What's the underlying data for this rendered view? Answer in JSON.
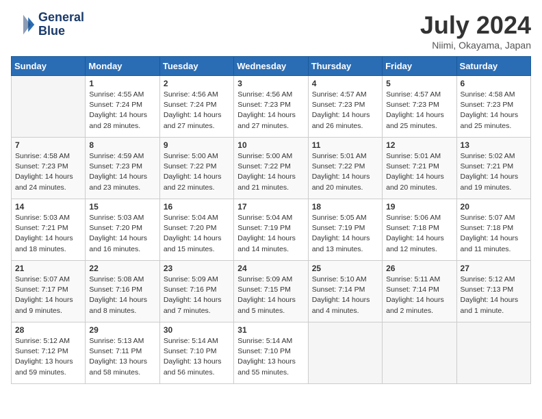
{
  "header": {
    "logo_line1": "General",
    "logo_line2": "Blue",
    "month_title": "July 2024",
    "location": "Niimi, Okayama, Japan"
  },
  "weekdays": [
    "Sunday",
    "Monday",
    "Tuesday",
    "Wednesday",
    "Thursday",
    "Friday",
    "Saturday"
  ],
  "weeks": [
    [
      {
        "day": "",
        "content": ""
      },
      {
        "day": "1",
        "content": "Sunrise: 4:55 AM\nSunset: 7:24 PM\nDaylight: 14 hours\nand 28 minutes."
      },
      {
        "day": "2",
        "content": "Sunrise: 4:56 AM\nSunset: 7:24 PM\nDaylight: 14 hours\nand 27 minutes."
      },
      {
        "day": "3",
        "content": "Sunrise: 4:56 AM\nSunset: 7:23 PM\nDaylight: 14 hours\nand 27 minutes."
      },
      {
        "day": "4",
        "content": "Sunrise: 4:57 AM\nSunset: 7:23 PM\nDaylight: 14 hours\nand 26 minutes."
      },
      {
        "day": "5",
        "content": "Sunrise: 4:57 AM\nSunset: 7:23 PM\nDaylight: 14 hours\nand 25 minutes."
      },
      {
        "day": "6",
        "content": "Sunrise: 4:58 AM\nSunset: 7:23 PM\nDaylight: 14 hours\nand 25 minutes."
      }
    ],
    [
      {
        "day": "7",
        "content": "Sunrise: 4:58 AM\nSunset: 7:23 PM\nDaylight: 14 hours\nand 24 minutes."
      },
      {
        "day": "8",
        "content": "Sunrise: 4:59 AM\nSunset: 7:23 PM\nDaylight: 14 hours\nand 23 minutes."
      },
      {
        "day": "9",
        "content": "Sunrise: 5:00 AM\nSunset: 7:22 PM\nDaylight: 14 hours\nand 22 minutes."
      },
      {
        "day": "10",
        "content": "Sunrise: 5:00 AM\nSunset: 7:22 PM\nDaylight: 14 hours\nand 21 minutes."
      },
      {
        "day": "11",
        "content": "Sunrise: 5:01 AM\nSunset: 7:22 PM\nDaylight: 14 hours\nand 20 minutes."
      },
      {
        "day": "12",
        "content": "Sunrise: 5:01 AM\nSunset: 7:21 PM\nDaylight: 14 hours\nand 20 minutes."
      },
      {
        "day": "13",
        "content": "Sunrise: 5:02 AM\nSunset: 7:21 PM\nDaylight: 14 hours\nand 19 minutes."
      }
    ],
    [
      {
        "day": "14",
        "content": "Sunrise: 5:03 AM\nSunset: 7:21 PM\nDaylight: 14 hours\nand 18 minutes."
      },
      {
        "day": "15",
        "content": "Sunrise: 5:03 AM\nSunset: 7:20 PM\nDaylight: 14 hours\nand 16 minutes."
      },
      {
        "day": "16",
        "content": "Sunrise: 5:04 AM\nSunset: 7:20 PM\nDaylight: 14 hours\nand 15 minutes."
      },
      {
        "day": "17",
        "content": "Sunrise: 5:04 AM\nSunset: 7:19 PM\nDaylight: 14 hours\nand 14 minutes."
      },
      {
        "day": "18",
        "content": "Sunrise: 5:05 AM\nSunset: 7:19 PM\nDaylight: 14 hours\nand 13 minutes."
      },
      {
        "day": "19",
        "content": "Sunrise: 5:06 AM\nSunset: 7:18 PM\nDaylight: 14 hours\nand 12 minutes."
      },
      {
        "day": "20",
        "content": "Sunrise: 5:07 AM\nSunset: 7:18 PM\nDaylight: 14 hours\nand 11 minutes."
      }
    ],
    [
      {
        "day": "21",
        "content": "Sunrise: 5:07 AM\nSunset: 7:17 PM\nDaylight: 14 hours\nand 9 minutes."
      },
      {
        "day": "22",
        "content": "Sunrise: 5:08 AM\nSunset: 7:16 PM\nDaylight: 14 hours\nand 8 minutes."
      },
      {
        "day": "23",
        "content": "Sunrise: 5:09 AM\nSunset: 7:16 PM\nDaylight: 14 hours\nand 7 minutes."
      },
      {
        "day": "24",
        "content": "Sunrise: 5:09 AM\nSunset: 7:15 PM\nDaylight: 14 hours\nand 5 minutes."
      },
      {
        "day": "25",
        "content": "Sunrise: 5:10 AM\nSunset: 7:14 PM\nDaylight: 14 hours\nand 4 minutes."
      },
      {
        "day": "26",
        "content": "Sunrise: 5:11 AM\nSunset: 7:14 PM\nDaylight: 14 hours\nand 2 minutes."
      },
      {
        "day": "27",
        "content": "Sunrise: 5:12 AM\nSunset: 7:13 PM\nDaylight: 14 hours\nand 1 minute."
      }
    ],
    [
      {
        "day": "28",
        "content": "Sunrise: 5:12 AM\nSunset: 7:12 PM\nDaylight: 13 hours\nand 59 minutes."
      },
      {
        "day": "29",
        "content": "Sunrise: 5:13 AM\nSunset: 7:11 PM\nDaylight: 13 hours\nand 58 minutes."
      },
      {
        "day": "30",
        "content": "Sunrise: 5:14 AM\nSunset: 7:10 PM\nDaylight: 13 hours\nand 56 minutes."
      },
      {
        "day": "31",
        "content": "Sunrise: 5:14 AM\nSunset: 7:10 PM\nDaylight: 13 hours\nand 55 minutes."
      },
      {
        "day": "",
        "content": ""
      },
      {
        "day": "",
        "content": ""
      },
      {
        "day": "",
        "content": ""
      }
    ]
  ]
}
